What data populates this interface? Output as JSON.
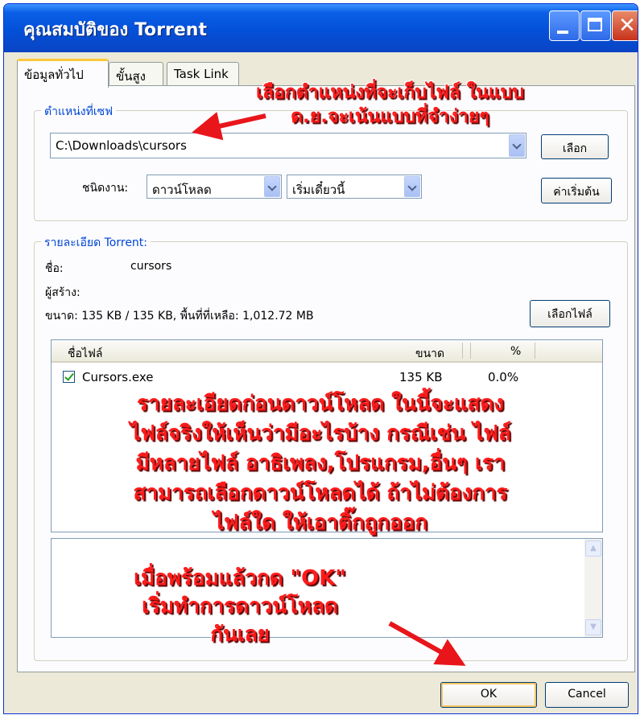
{
  "window": {
    "title": "คุณสมบัติของ Torrent",
    "close_glyph": "✕"
  },
  "tabs": [
    {
      "label": "ข้อมูลทั่วไป"
    },
    {
      "label": "ขั้นสูง"
    },
    {
      "label": "Task Link"
    }
  ],
  "save_location": {
    "legend": "ตำแหน่งที่เซฟ",
    "path_value": "C:\\Downloads\\cursors",
    "browse_button": "เลือก",
    "task_type_label": "ชนิดงาน:",
    "task_type_value": "ดาวน์โหลด",
    "start_value": "เริ่มเดี๋ยวนี้",
    "defaults_button": "ค่าเริ่มต้น"
  },
  "torrent_details": {
    "legend": "รายละเอียด Torrent:",
    "name_label": "ชื่อ:",
    "name_value": "cursors",
    "creator_label": "ผู้สร้าง:",
    "size_text": "ขนาด: 135 KB / 135 KB, พื้นที่ที่เหลือ: 1,012.72 MB",
    "select_files_button": "เลือกไฟล์"
  },
  "file_list": {
    "columns": [
      "ชื่อไฟล์",
      "ขนาด",
      "%"
    ],
    "rows": [
      {
        "checked": true,
        "name": "Cursors.exe",
        "size": "135 KB",
        "percent": "0.0%"
      }
    ]
  },
  "buttons": {
    "ok": "OK",
    "cancel": "Cancel"
  },
  "annotations": {
    "top_line1": "เลือกตำแหน่งที่จะเก็บไฟล์ ในแบบ",
    "top_line2": "ด.ย.จะเน้นแบบที่จำง่ายๆ",
    "middle_lines": [
      "รายละเอียดก่อนดาวน์โหลด ในนี้จะแสดง",
      "ไฟล์จริงให้เห็นว่ามีอะไรบ้าง กรณีเช่น ไฟล์",
      "มีหลายไฟล์ อาธิเพลง,โปรแกรม,อื่นๆ เรา",
      "สามารถเลือกดาวน์โหลดได้ ถ้าไม่ต้องการ",
      "ไฟล์ใด ให้เอาติ๊กถูกออก"
    ],
    "bottom_lines": [
      "เมื่อพร้อมแล้วกด \"OK\"",
      "เริ่มทำการดาวน์โหลด",
      "กันเลย"
    ],
    "color": "#ff1a1a"
  },
  "colors": {
    "titlebar": "#0450d8",
    "group_legend": "#0046d5",
    "dialog_bg": "#ece9d8"
  }
}
